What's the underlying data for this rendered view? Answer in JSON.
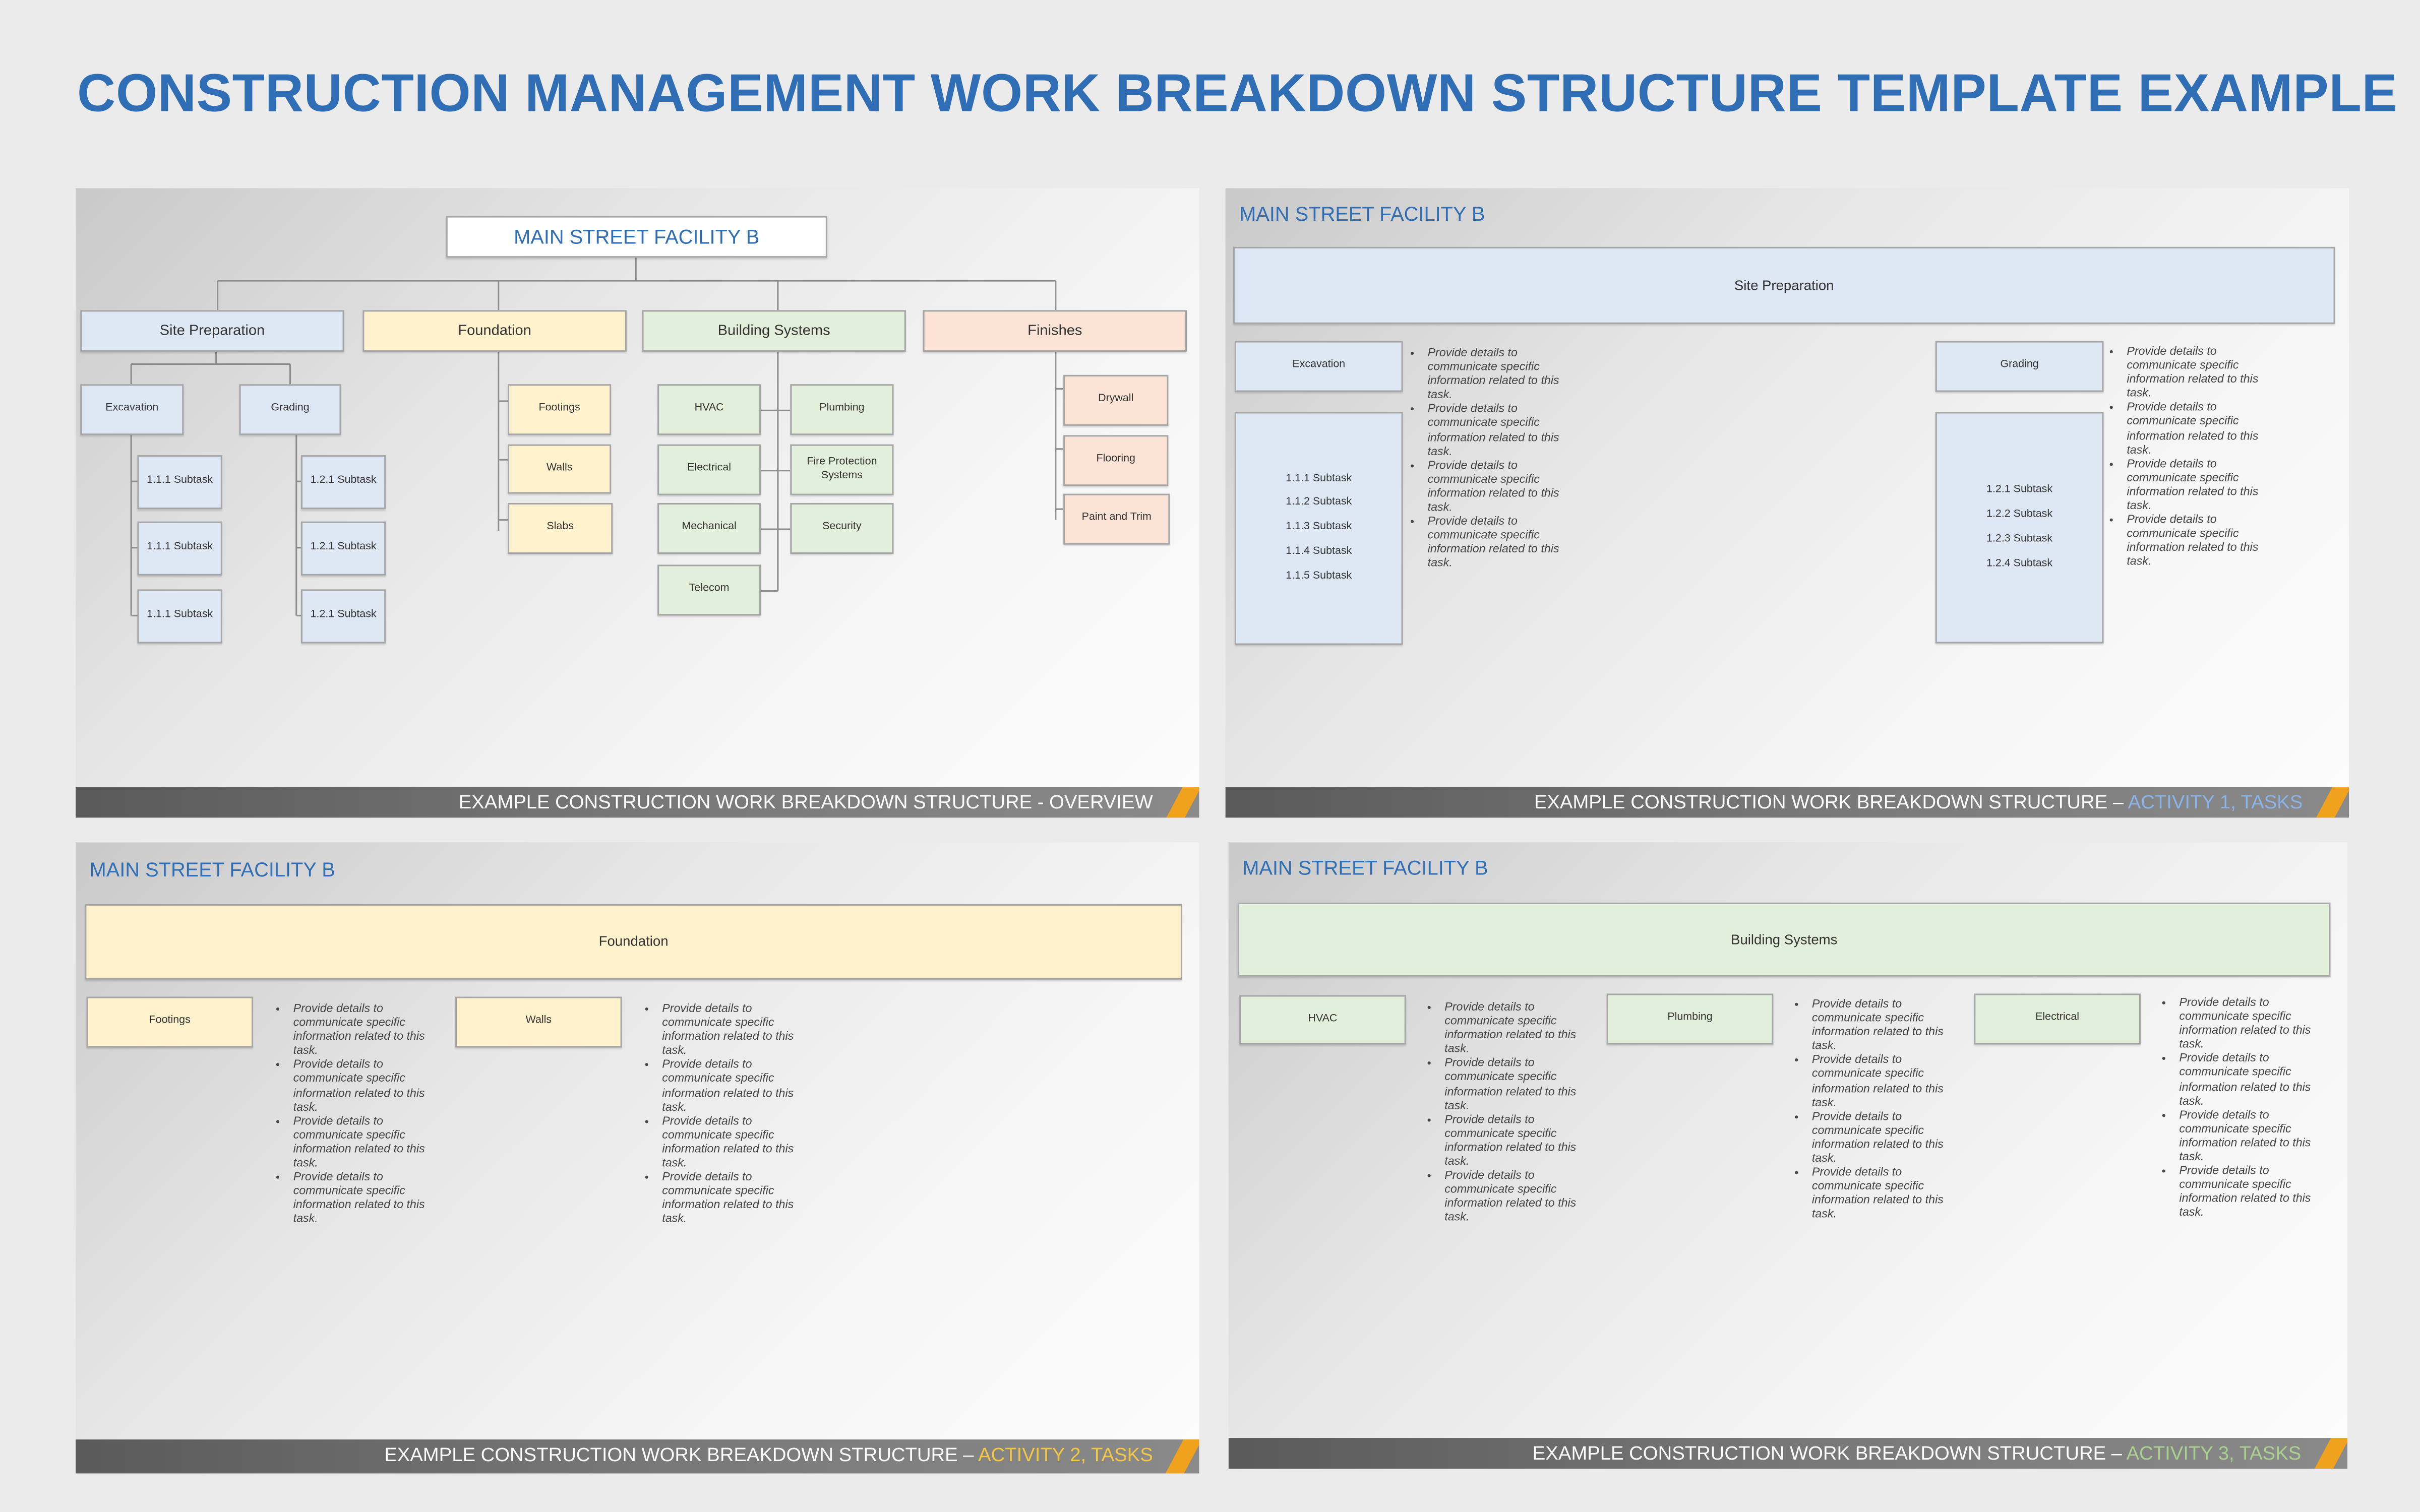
{
  "title": "CONSTRUCTION MANAGEMENT WORK BREAKDOWN STRUCTURE TEMPLATE EXAMPLE",
  "colors": {
    "title": "#2f6eb5",
    "site_preparation": "#dee8f5",
    "foundation": "#fff2cc",
    "building_systems": "#e2efda",
    "finishes": "#fbe4d5",
    "footer_accent": "#f0a21e",
    "activity1": "#8ab4e8",
    "activity2": "#f2c744",
    "activity3": "#a9d18e"
  },
  "overview": {
    "root": "MAIN STREET FACILITY B",
    "site_preparation": {
      "label": "Site Preparation",
      "excavation": "Excavation",
      "grading": "Grading",
      "excavation_subtasks": [
        "1.1.1 Subtask",
        "1.1.1 Subtask",
        "1.1.1 Subtask"
      ],
      "grading_subtasks": [
        "1.2.1 Subtask",
        "1.2.1 Subtask",
        "1.2.1 Subtask"
      ]
    },
    "foundation": {
      "label": "Foundation",
      "items": [
        "Footings",
        "Walls",
        "Slabs"
      ]
    },
    "building_systems": {
      "label": "Building Systems",
      "items": [
        "HVAC",
        "Plumbing",
        "Electrical",
        "Fire Protection Systems",
        "Mechanical",
        "Security",
        "Telecom"
      ]
    },
    "finishes": {
      "label": "Finishes",
      "items": [
        "Drywall",
        "Flooring",
        "Paint and Trim"
      ]
    },
    "footer": "EXAMPLE CONSTRUCTION WORK BREAKDOWN STRUCTURE - OVERVIEW"
  },
  "activity1": {
    "header": "MAIN STREET FACILITY B",
    "title": "Site Preparation",
    "tasks": [
      {
        "label": "Excavation",
        "subtasks": [
          "1.1.1 Subtask",
          "1.1.2 Subtask",
          "1.1.3 Subtask",
          "1.1.4 Subtask",
          "1.1.5 Subtask"
        ]
      },
      {
        "label": "Grading",
        "subtasks": [
          "1.2.1 Subtask",
          "1.2.2 Subtask",
          "1.2.3 Subtask",
          "1.2.4 Subtask"
        ]
      }
    ],
    "footer": "EXAMPLE CONSTRUCTION WORK BREAKDOWN STRUCTURE – ",
    "footer_highlight": "ACTIVITY 1, TASKS"
  },
  "activity2": {
    "header": "MAIN STREET FACILITY B",
    "title": "Foundation",
    "tasks": [
      {
        "label": "Footings"
      },
      {
        "label": "Walls"
      }
    ],
    "footer": "EXAMPLE CONSTRUCTION WORK BREAKDOWN STRUCTURE – ",
    "footer_highlight": "ACTIVITY 2, TASKS"
  },
  "activity3": {
    "header": "MAIN STREET FACILITY B",
    "title": "Building Systems",
    "tasks": [
      {
        "label": "HVAC"
      },
      {
        "label": "Plumbing"
      },
      {
        "label": "Electrical"
      }
    ],
    "footer": "EXAMPLE CONSTRUCTION WORK BREAKDOWN STRUCTURE – ",
    "footer_highlight": "ACTIVITY 3, TASKS"
  },
  "bullet_text": [
    "Provide details to communicate specific information related to this task.",
    "Provide details to communicate specific information related to this task.",
    "Provide details to communicate specific information related to this task.",
    "Provide details to communicate specific information related to this task."
  ]
}
